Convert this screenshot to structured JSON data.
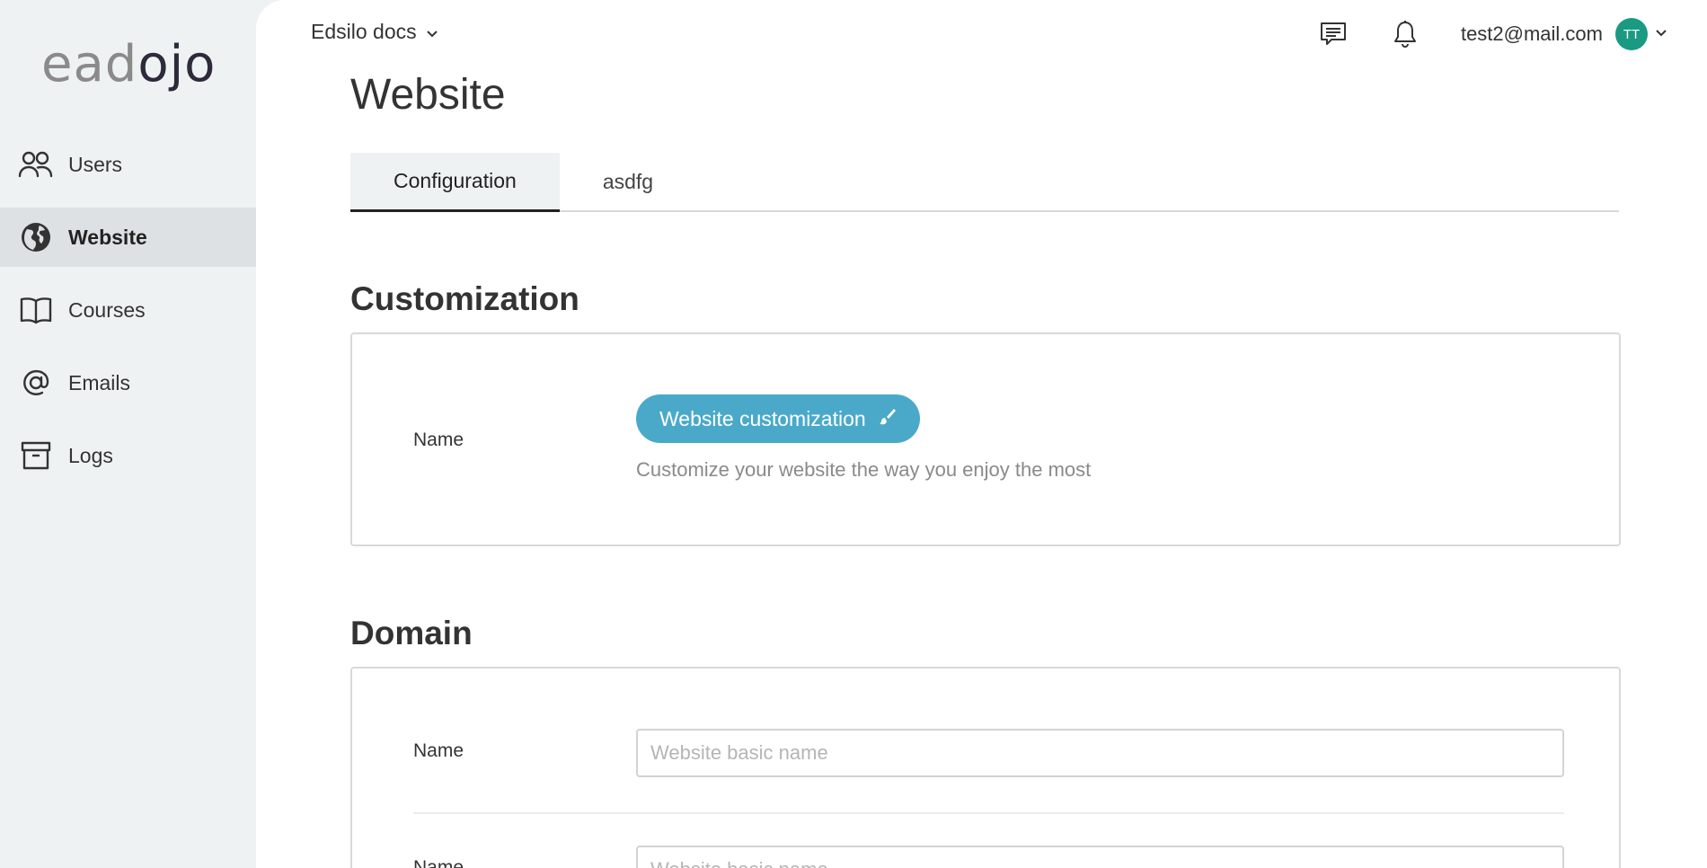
{
  "app": {
    "logo_part1": "ead",
    "logo_part2": "ojo"
  },
  "sidebar": {
    "items": [
      {
        "label": "Users",
        "icon": "users-icon",
        "active": false
      },
      {
        "label": "Website",
        "icon": "globe-icon",
        "active": true
      },
      {
        "label": "Courses",
        "icon": "book-icon",
        "active": false
      },
      {
        "label": "Emails",
        "icon": "at-icon",
        "active": false
      },
      {
        "label": "Logs",
        "icon": "archive-icon",
        "active": false
      }
    ]
  },
  "topbar": {
    "workspace": "Edsilo docs",
    "user_email": "test2@mail.com",
    "avatar_initials": "TT",
    "avatar_color": "#1a9a82"
  },
  "page": {
    "title": "Website",
    "tabs": [
      {
        "label": "Configuration",
        "active": true
      },
      {
        "label": "asdfg",
        "active": false
      }
    ]
  },
  "customization": {
    "title": "Customization",
    "field_label": "Name",
    "button_label": "Website customization",
    "help_text": "Customize your website the way you enjoy the most",
    "accent_color": "#4aa9c9"
  },
  "domain": {
    "title": "Domain",
    "fields": [
      {
        "label": "Name",
        "placeholder": "Website basic name",
        "value": ""
      },
      {
        "label": "Name",
        "placeholder": "Website basic name",
        "value": ""
      }
    ]
  }
}
